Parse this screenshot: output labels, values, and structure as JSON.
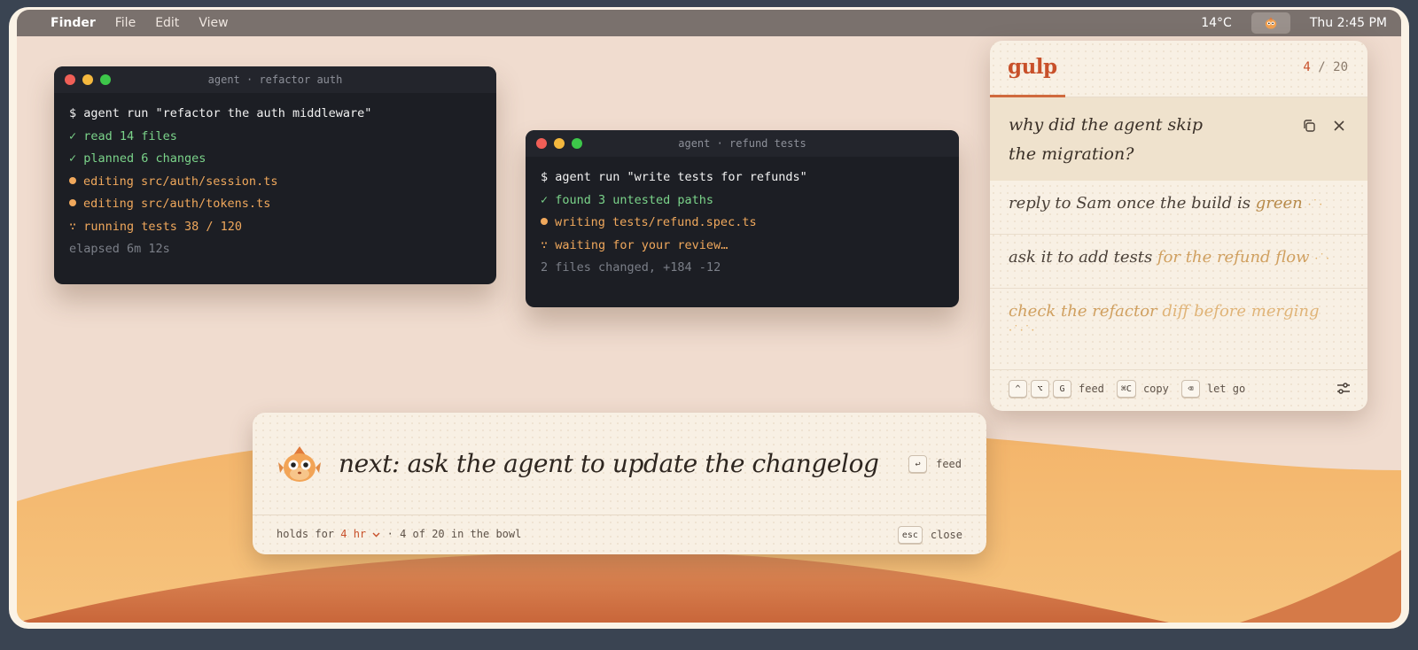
{
  "menubar": {
    "app": "Finder",
    "menus": [
      "File",
      "Edit",
      "View"
    ],
    "temperature": "14°C",
    "tray_icon": "fish-mascot-icon",
    "clock": "Thu 2:45 PM"
  },
  "terminals": [
    {
      "title": "agent · refactor auth",
      "lines": [
        "$ agent run \"refactor the auth middleware\"",
        "✓ read 14 files",
        "✓ planned 6 changes",
        "editing src/auth/session.ts",
        "editing src/auth/tokens.ts",
        "∵ running tests 38 / 120",
        "elapsed 6m 12s"
      ]
    },
    {
      "title": "agent · refund tests",
      "lines": [
        "$ agent run \"write tests for refunds\"",
        "✓ found 3 untested paths",
        "writing tests/refund.spec.ts",
        "∵ waiting for your review…",
        "2 files changed, +184 -12"
      ]
    }
  ],
  "gulp": {
    "logo": "gulp",
    "count_current": "4",
    "count_sep": "/",
    "count_total": "20",
    "progress": 0.2,
    "active_item": "why did the agent skip the migration?",
    "items": [
      {
        "a": "reply to Sam once the build is ",
        "b": "green"
      },
      {
        "a": "ask it to add tests ",
        "b": "for the refund flow"
      },
      {
        "a": "check the refactor ",
        "b": "diff before merging"
      }
    ],
    "footer": {
      "feed_keys": [
        "^",
        "⌥",
        "G"
      ],
      "feed_label": "feed",
      "copy_key": "⌘C",
      "copy_label": "copy",
      "letgo_key": "⌫",
      "letgo_label": "let go"
    },
    "colors": {
      "accent": "#c8502a"
    }
  },
  "next_bar": {
    "text": "next: ask the agent to update the changelog",
    "feed_key": "↩",
    "feed_label": "feed",
    "holds_prefix": "holds for ",
    "holds_value": "4 hr",
    "holds_suffix": "· 4 of 20 in the bowl",
    "esc_key": "esc",
    "close_label": "close"
  }
}
